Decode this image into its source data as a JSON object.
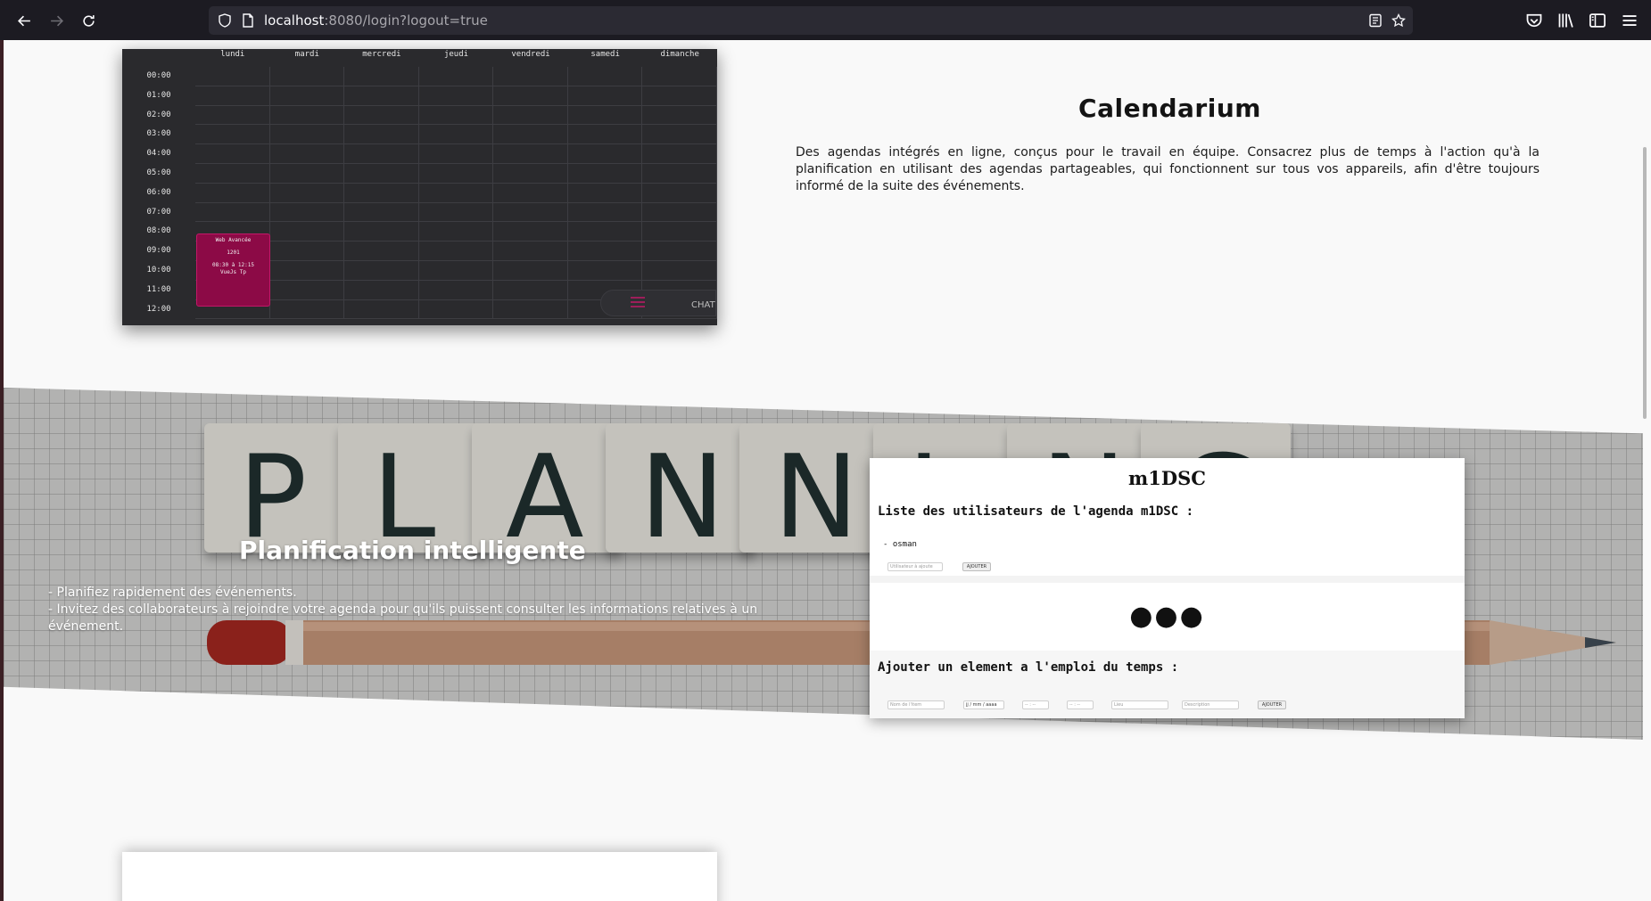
{
  "browser": {
    "url_host": "localhost",
    "url_rest": ":8080/login?logout=true"
  },
  "calendar_preview": {
    "days": [
      "lundi",
      "mardi",
      "mercredi",
      "jeudi",
      "vendredi",
      "samedi",
      "dimanche"
    ],
    "hours": [
      "00:00",
      "01:00",
      "02:00",
      "03:00",
      "04:00",
      "05:00",
      "06:00",
      "07:00",
      "08:00",
      "09:00",
      "10:00",
      "11:00",
      "12:00"
    ],
    "event": {
      "title": "Web Avancée",
      "room": "1201",
      "time": "08:30 à 12:15",
      "description": "VueJs Tp",
      "color": "#8c0a46"
    },
    "chat_label": "CHAT"
  },
  "feature1": {
    "title": "Calendarium",
    "description": "Des agendas intégrés en ligne, conçus pour le travail en équipe. Consacrez plus de temps à l'action qu'à la planification en utilisant des agendas partageables, qui fonctionnent sur tous vos appareils, afin d'être toujours informé de la suite des événements."
  },
  "banner": {
    "letters": [
      "P",
      "L",
      "A",
      "N",
      "N",
      "I",
      "N",
      "G"
    ]
  },
  "feature2": {
    "title": "Planification intelligente",
    "line1": "- Planifiez rapidement des événements.",
    "line2": "- Invitez des collaborateurs à rejoindre votre agenda pour qu'ils puissent consulter les informations relatives à un événement."
  },
  "app_preview": {
    "agenda_name": "m1DSC",
    "users_heading": "Liste des utilisateurs de l'agenda m1DSC :",
    "users": [
      "- osman"
    ],
    "user_input_placeholder": "Utilisateur à ajoute",
    "add_button": "AJOUTER",
    "dots": "●●●",
    "add_element_heading": "Ajouter un element a l'emploi du temps :",
    "form": {
      "item_name_placeholder": "Nom de l'item",
      "date_placeholder": "jj / mm / aaaa",
      "start_time_placeholder": "-- : --",
      "end_time_placeholder": "-- : --",
      "place_placeholder": "Lieu",
      "description_placeholder": "Description",
      "submit": "AJOUTER"
    }
  }
}
